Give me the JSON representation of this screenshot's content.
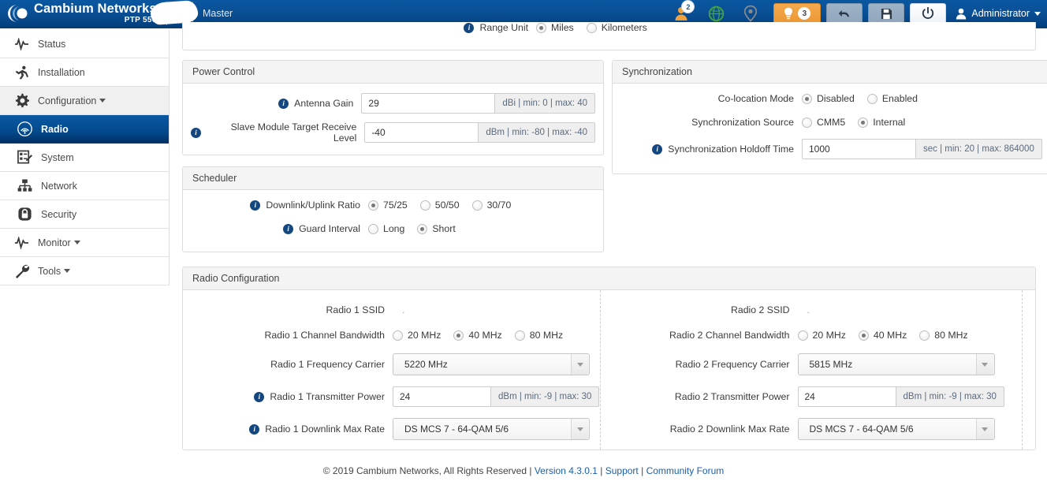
{
  "header": {
    "brand_name": "Cambium Networks",
    "brand_model": "PTP 550",
    "device_name_redacted": "A",
    "role": "Master",
    "user_badge_count": "2",
    "tips_badge_count": "3",
    "admin_label": "Administrator",
    "icons": {
      "users": "user-icon",
      "globe": "globe-icon",
      "location": "map-pin-icon",
      "tips": "lightbulb-icon",
      "undo": "undo-icon",
      "save": "save-icon",
      "power": "power-icon",
      "admin": "user-avatar-icon"
    },
    "colors": {
      "header_start": "#0a57a0",
      "header_end": "#023f7d",
      "accent_orange": "#eb9833"
    }
  },
  "sidebar": {
    "items": [
      {
        "label": "Status",
        "icon": "pulse-icon",
        "level": 1,
        "state": "normal",
        "caret": false
      },
      {
        "label": "Installation",
        "icon": "runner-icon",
        "level": 1,
        "state": "normal",
        "caret": false
      },
      {
        "label": "Configuration",
        "icon": "gear-icon",
        "level": 1,
        "state": "expanded",
        "caret": true
      },
      {
        "label": "Radio",
        "icon": "antenna-icon",
        "level": 2,
        "state": "active",
        "caret": false
      },
      {
        "label": "System",
        "icon": "checklist-icon",
        "level": 2,
        "state": "normal",
        "caret": false
      },
      {
        "label": "Network",
        "icon": "network-icon",
        "level": 2,
        "state": "normal",
        "caret": false
      },
      {
        "label": "Security",
        "icon": "lock-icon",
        "level": 2,
        "state": "normal",
        "caret": false
      },
      {
        "label": "Monitor",
        "icon": "pulse-icon",
        "level": 1,
        "state": "normal",
        "caret": true
      },
      {
        "label": "Tools",
        "icon": "wrench-icon",
        "level": 1,
        "state": "normal",
        "caret": true
      }
    ]
  },
  "clipped_panel": {
    "range_unit": {
      "label": "Range Unit",
      "has_info": true,
      "options": [
        "Miles",
        "Kilometers"
      ],
      "selected": "Miles"
    }
  },
  "power_control": {
    "title": "Power Control",
    "antenna_gain": {
      "label": "Antenna Gain",
      "has_info": true,
      "value": "29",
      "suffix": "dBi | min: 0 | max: 40"
    },
    "slave_rx_level": {
      "label": "Slave Module Target Receive Level",
      "has_info": true,
      "value": "-40",
      "suffix": "dBm | min: -80 | max: -40"
    }
  },
  "scheduler": {
    "title": "Scheduler",
    "dl_ul_ratio": {
      "label": "Downlink/Uplink Ratio",
      "has_info": true,
      "options": [
        "75/25",
        "50/50",
        "30/70"
      ],
      "selected": "75/25"
    },
    "guard_interval": {
      "label": "Guard Interval",
      "has_info": true,
      "options": [
        "Long",
        "Short"
      ],
      "selected": "Short"
    }
  },
  "synchronization": {
    "title": "Synchronization",
    "co_location_mode": {
      "label": "Co-location Mode",
      "has_info": false,
      "options": [
        "Disabled",
        "Enabled"
      ],
      "selected": "Disabled"
    },
    "sync_source": {
      "label": "Synchronization Source",
      "has_info": false,
      "options": [
        "CMM5",
        "Internal"
      ],
      "selected": "Internal"
    },
    "sync_holdoff_time": {
      "label": "Synchronization Holdoff Time",
      "has_info": true,
      "value": "1000",
      "suffix": "sec | min: 20 | max: 864000"
    }
  },
  "radio_configuration": {
    "title": "Radio Configuration",
    "radio1": {
      "ssid": {
        "label": "Radio 1 SSID",
        "has_info": false,
        "value": "."
      },
      "bandwidth": {
        "label": "Radio 1 Channel Bandwidth",
        "has_info": false,
        "options": [
          "20 MHz",
          "40 MHz",
          "80 MHz"
        ],
        "selected": "40 MHz"
      },
      "frequency": {
        "label": "Radio 1 Frequency Carrier",
        "has_info": false,
        "value": "5220 MHz"
      },
      "tx_power": {
        "label": "Radio 1 Transmitter Power",
        "has_info": true,
        "value": "24",
        "suffix": "dBm | min: -9 | max: 30"
      },
      "max_rate": {
        "label": "Radio 1 Downlink Max Rate",
        "has_info": true,
        "value": "DS MCS 7 - 64-QAM 5/6"
      }
    },
    "radio2": {
      "ssid": {
        "label": "Radio 2 SSID",
        "has_info": false,
        "value": "."
      },
      "bandwidth": {
        "label": "Radio 2 Channel Bandwidth",
        "has_info": false,
        "options": [
          "20 MHz",
          "40 MHz",
          "80 MHz"
        ],
        "selected": "40 MHz"
      },
      "frequency": {
        "label": "Radio 2 Frequency Carrier",
        "has_info": false,
        "value": "5815 MHz"
      },
      "tx_power": {
        "label": "Radio 2 Transmitter Power",
        "has_info": false,
        "value": "24",
        "suffix": "dBm | min: -9 | max: 30"
      },
      "max_rate": {
        "label": "Radio 2 Downlink Max Rate",
        "has_info": false,
        "value": "DS MCS 7 - 64-QAM 5/6"
      }
    }
  },
  "footer": {
    "copyright": "© 2019 Cambium Networks, All Rights Reserved",
    "sep": "|",
    "version": "Version 4.3.0.1",
    "support": "Support",
    "community": "Community Forum"
  }
}
